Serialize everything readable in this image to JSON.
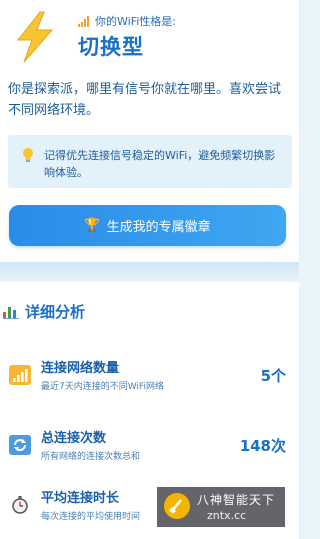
{
  "header": {
    "type_prefix": "你的WiFi性格是:",
    "type_title": "切换型",
    "description": "你是探索派，哪里有信号你就在哪里。喜欢尝试不同网络环境。",
    "tip": "记得优先连接信号稳定的WiFi，避免频繁切换影响体验。",
    "badge_button": "生成我的专属徽章"
  },
  "analysis": {
    "title": "详细分析",
    "stats": [
      {
        "label": "连接网络数量",
        "sub": "最近7天内连接的不同WiFi网络",
        "value": "5个",
        "icon": "signal-bars-icon"
      },
      {
        "label": "总连接次数",
        "sub": "所有网络的连接次数总和",
        "value": "148次",
        "icon": "refresh-icon"
      },
      {
        "label": "平均连接时长",
        "sub": "每次连接的平均使用时间",
        "value": "",
        "icon": "stopwatch-icon"
      }
    ]
  },
  "watermark": {
    "title": "八神智能天下",
    "url": "zntx.cc"
  },
  "colors": {
    "accent": "#1a6fc7",
    "button": "#2a8ce8",
    "tip_bg": "#e3f1fb",
    "page_bg": "#eaf4fb"
  }
}
